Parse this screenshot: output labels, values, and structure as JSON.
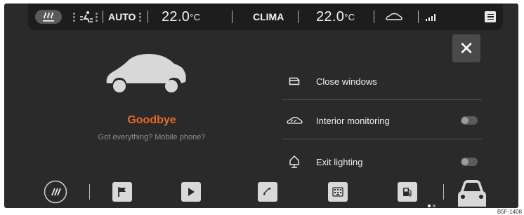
{
  "topbar": {
    "left_temp_value": "22.0",
    "left_temp_unit": "°C",
    "auto_label": "AUTO",
    "clima_label": "CLIMA",
    "right_temp_value": "22.0",
    "right_temp_unit": "°C"
  },
  "goodbye": {
    "title": "Goodbye",
    "subtitle": "Got everything? Mobile phone?"
  },
  "options": [
    {
      "label": "Close windows",
      "icon": "window-icon"
    },
    {
      "label": "Interior monitoring",
      "icon": "interior-monitoring-icon",
      "toggle": "off"
    },
    {
      "label": "Exit lighting",
      "icon": "exit-lighting-icon",
      "toggle": "off"
    }
  ],
  "dock": {
    "items": [
      "rear-window-heat-icon",
      "flag-icon",
      "play-icon",
      "phone-icon",
      "keypad-icon",
      "fuel-icon",
      "car-front-icon"
    ],
    "pages": 2,
    "current_page": 1
  },
  "image_code": "B5F-1408",
  "colors": {
    "accent": "#e56b28",
    "background": "#2a2a2a",
    "topbar": "#1d1d1d"
  }
}
